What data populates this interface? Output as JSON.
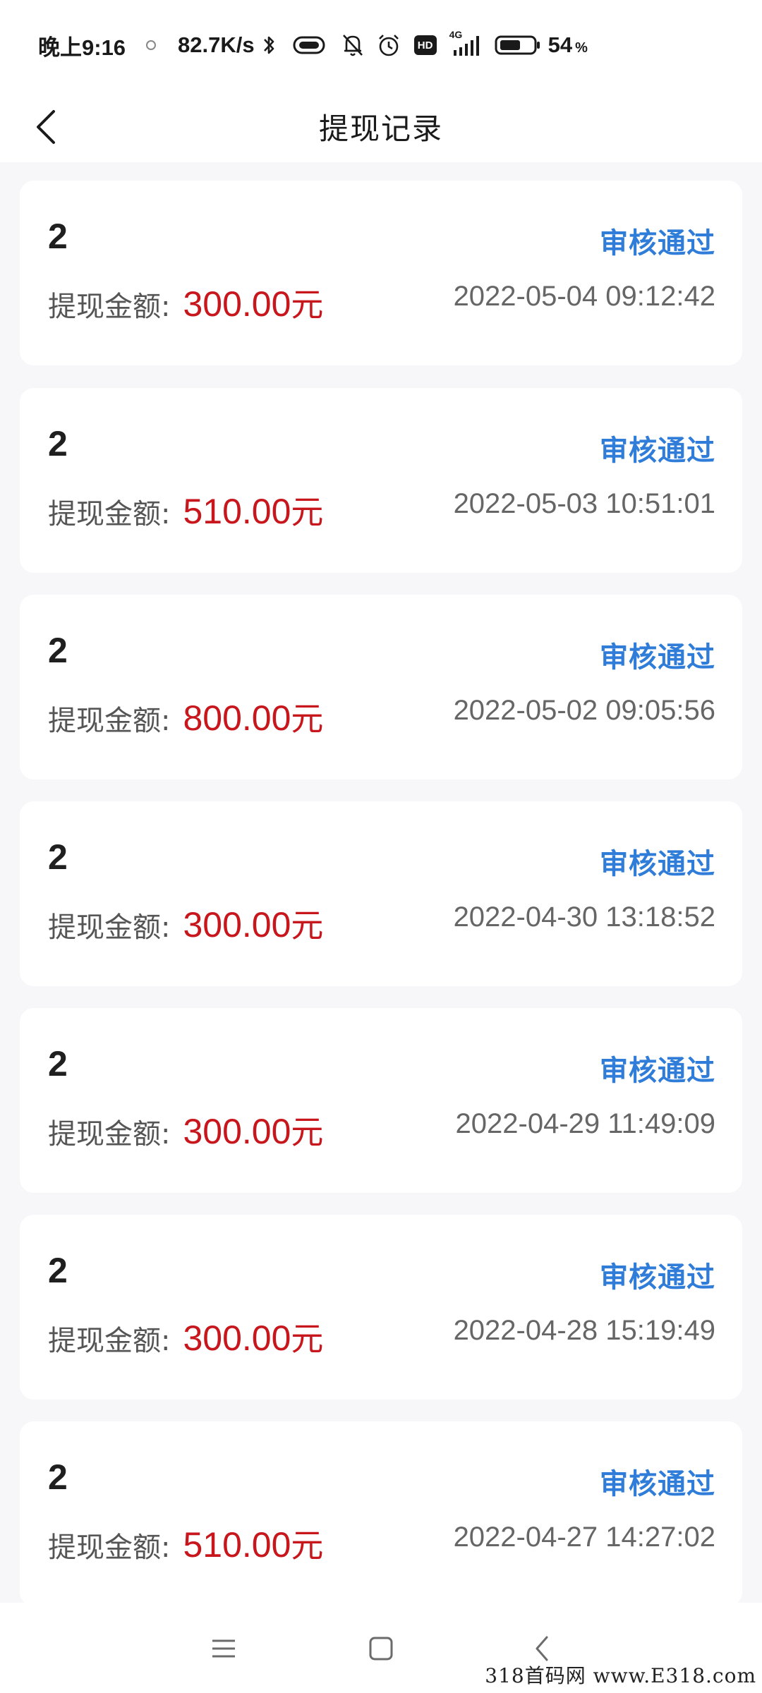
{
  "status_bar": {
    "time": "晚上9:16",
    "speed": "82.7K/s",
    "network": "4G",
    "battery_percent": "54",
    "battery_unit": "%",
    "hd": "HD"
  },
  "header": {
    "title": "提现记录"
  },
  "records": [
    {
      "count": "2",
      "status": "审核通过",
      "amount_label": "提现金额:",
      "amount": "300.00",
      "unit": "元",
      "time": "2022-05-04 09:12:42"
    },
    {
      "count": "2",
      "status": "审核通过",
      "amount_label": "提现金额:",
      "amount": "510.00",
      "unit": "元",
      "time": "2022-05-03 10:51:01"
    },
    {
      "count": "2",
      "status": "审核通过",
      "amount_label": "提现金额:",
      "amount": "800.00",
      "unit": "元",
      "time": "2022-05-02 09:05:56"
    },
    {
      "count": "2",
      "status": "审核通过",
      "amount_label": "提现金额:",
      "amount": "300.00",
      "unit": "元",
      "time": "2022-04-30 13:18:52"
    },
    {
      "count": "2",
      "status": "审核通过",
      "amount_label": "提现金额:",
      "amount": "300.00",
      "unit": "元",
      "time": "2022-04-29 11:49:09"
    },
    {
      "count": "2",
      "status": "审核通过",
      "amount_label": "提现金额:",
      "amount": "300.00",
      "unit": "元",
      "time": "2022-04-28 15:19:49"
    },
    {
      "count": "2",
      "status": "审核通过",
      "amount_label": "提现金额:",
      "amount": "510.00",
      "unit": "元",
      "time": "2022-04-27 14:27:02"
    }
  ],
  "colors": {
    "status_pass": "#2f7dd8",
    "amount": "#c8161d"
  },
  "icons": {
    "back": "chevron-left-icon",
    "menu": "menu-icon",
    "home": "home-icon",
    "nav_back": "nav-back-icon"
  },
  "watermark": "318首码网 www.E318.com"
}
